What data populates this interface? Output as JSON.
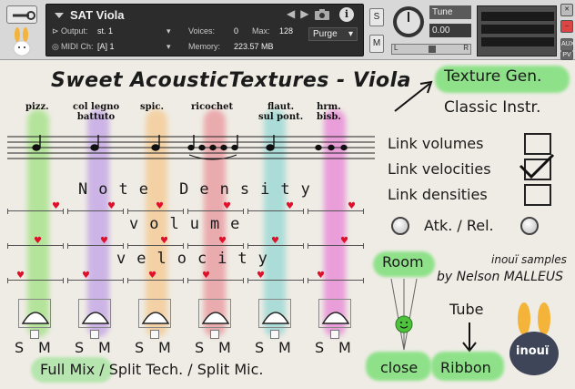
{
  "header": {
    "instrument_name": "SAT Viola",
    "output_label": "Output:",
    "output_value": "st. 1",
    "voices_label": "Voices:",
    "voices_value": "0",
    "max_label": "Max:",
    "max_value": "128",
    "purge_label": "Purge",
    "midi_label": "MIDI Ch:",
    "midi_value": "[A]  1",
    "memory_label": "Memory:",
    "memory_value": "223.57 MB",
    "solo_label": "S",
    "mute_label": "M",
    "tune_label": "Tune",
    "tune_value": "0.00",
    "pan_left": "L",
    "pan_right": "R",
    "aux_label": "AUX",
    "pv_label": "PV"
  },
  "title": "Sweet AcousticTextures - Viola",
  "techniques": [
    {
      "line1": "",
      "line2": "pizz."
    },
    {
      "line1": "col legno",
      "line2": "battuto"
    },
    {
      "line1": "",
      "line2": "spic."
    },
    {
      "line1": "",
      "line2": "ricochet"
    },
    {
      "line1": "flaut.",
      "line2": "sul pont."
    },
    {
      "line1": "hrm.",
      "line2": "bisb."
    }
  ],
  "sections": {
    "note_density": "Note Density",
    "volume": "volume",
    "velocity": "velocity"
  },
  "slider_levels": {
    "note_density": [
      0.95,
      0.85,
      0.6,
      0.75,
      0.8,
      0.85
    ],
    "volume": [
      0.55,
      0.7,
      0.7,
      0.65,
      0.5,
      0.7
    ],
    "velocity": [
      0.2,
      0.3,
      0.45,
      0.3,
      0.2,
      0.2
    ]
  },
  "channels": [
    {
      "solo": "S",
      "mute": "M"
    },
    {
      "solo": "S",
      "mute": "M"
    },
    {
      "solo": "S",
      "mute": "M"
    },
    {
      "solo": "S",
      "mute": "M"
    },
    {
      "solo": "S",
      "mute": "M"
    },
    {
      "solo": "S",
      "mute": "M"
    }
  ],
  "right_panel": {
    "texture_gen": "Texture Gen.",
    "classic_instr": "Classic Instr.",
    "link_volumes": "Link volumes",
    "link_velocities": "Link velocities",
    "link_densities": "Link densities",
    "link_velocities_checked": true,
    "atk_rel": "Atk. / Rel.",
    "credits_1": "inouï samples",
    "credits_2": "by Nelson MALLEUS",
    "room": "Room",
    "close": "close",
    "tube": "Tube",
    "ribbon": "Ribbon",
    "logo_text": "inouï"
  },
  "mix_modes": "Full Mix / Split Tech. / Split Mic.",
  "colors": {
    "streaks": [
      "#8ddf6a",
      "#b890e8",
      "#f6c07a",
      "#e8808a",
      "#7fd2cf",
      "#e66bd3"
    ],
    "highlight": "#7ee07a",
    "heart": "#e0102a",
    "logo_bg": "#3e4559",
    "bunny_ear": "#f4b43a"
  }
}
